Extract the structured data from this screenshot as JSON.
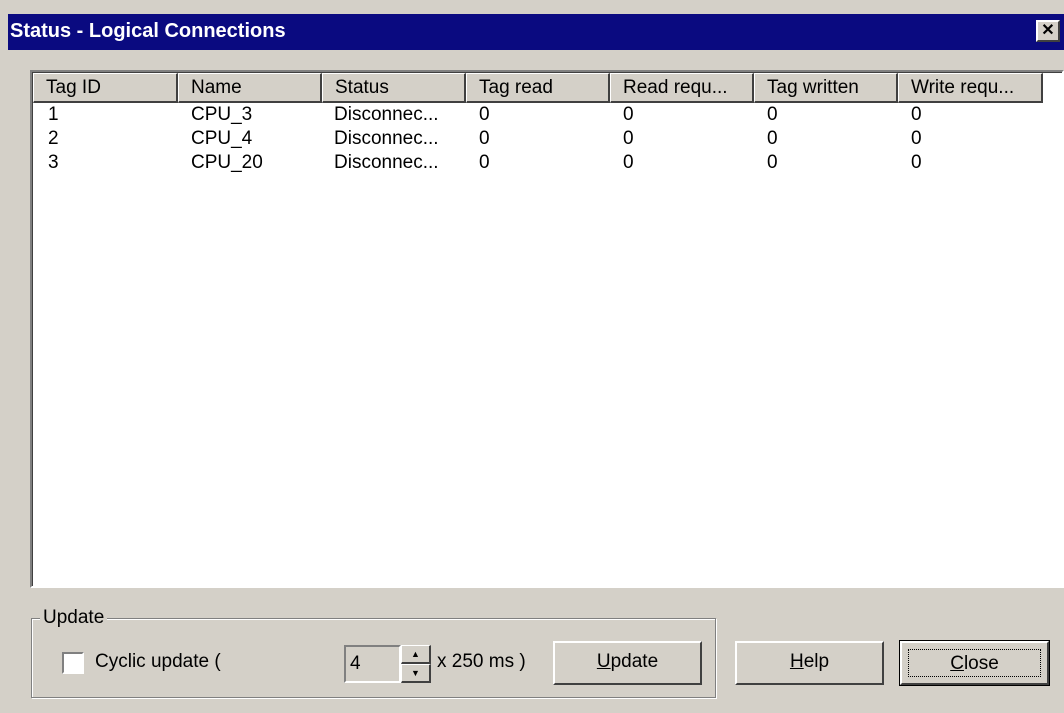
{
  "window": {
    "title": "Status - Logical Connections",
    "close_glyph": "✕"
  },
  "table": {
    "columns": [
      "Tag ID",
      "Name",
      "Status",
      "Tag read",
      "Read requ...",
      "Tag written",
      "Write requ..."
    ],
    "rows": [
      [
        "1",
        "CPU_3",
        "Disconnec...",
        "0",
        "0",
        "0",
        "0"
      ],
      [
        "2",
        "CPU_4",
        "Disconnec...",
        "0",
        "0",
        "0",
        "0"
      ],
      [
        "3",
        "CPU_20",
        "Disconnec...",
        "0",
        "0",
        "0",
        "0"
      ]
    ]
  },
  "update_group": {
    "label": "Update",
    "checkbox_label": "Cyclic update (",
    "checkbox_checked": false,
    "interval_value": "4",
    "unit_label": "x 250 ms )",
    "update_button": {
      "mnemonic": "U",
      "rest": "pdate"
    }
  },
  "buttons": {
    "help": {
      "mnemonic": "H",
      "rest": "elp"
    },
    "close": {
      "mnemonic": "C",
      "rest": "lose"
    }
  },
  "icons": {
    "close": "close-icon",
    "spin_up": "spin-up-icon",
    "spin_down": "spin-down-icon"
  }
}
